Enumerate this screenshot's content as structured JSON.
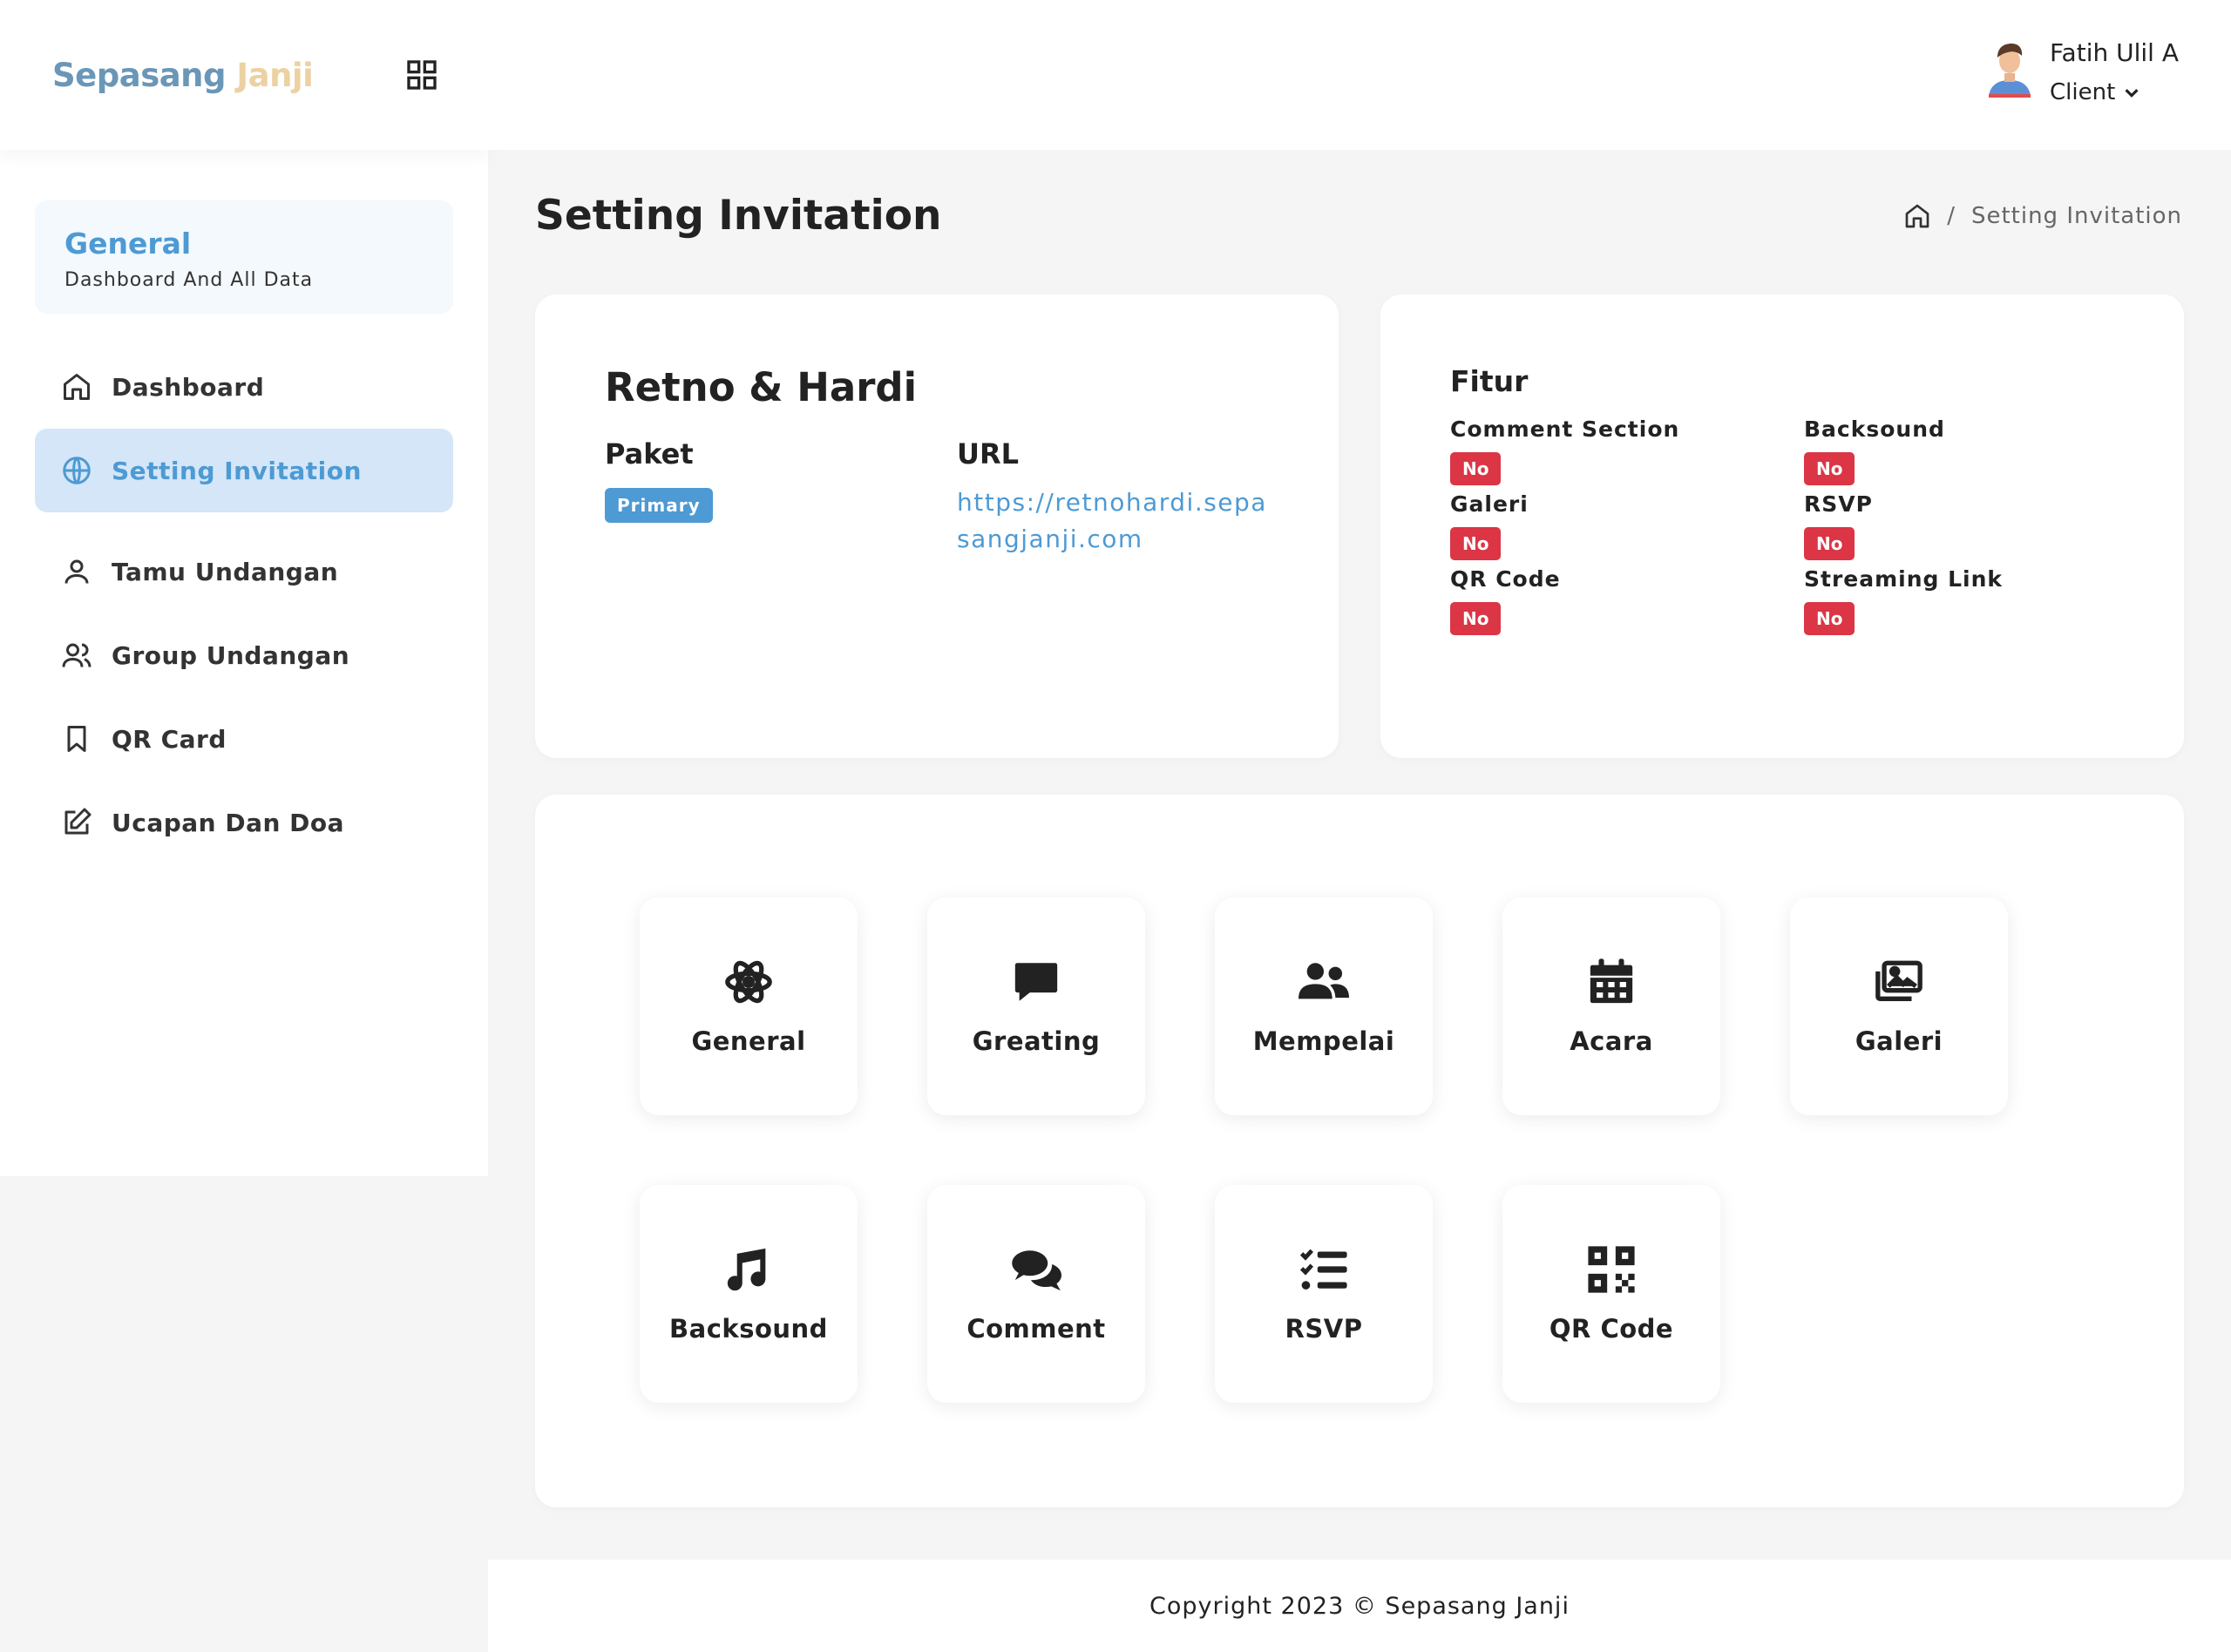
{
  "brand": {
    "part1": "Sepasang",
    "part2": "Janji"
  },
  "user": {
    "name": "Fatih Ulil A",
    "role": "Client"
  },
  "sidebar": {
    "section_title": "General",
    "section_subtitle": "Dashboard And All Data",
    "items": [
      {
        "label": "Dashboard",
        "icon": "home-icon"
      },
      {
        "label": "Setting Invitation",
        "icon": "globe-icon",
        "active": true
      },
      {
        "label": "Tamu Undangan",
        "icon": "user-icon"
      },
      {
        "label": "Group Undangan",
        "icon": "users-icon"
      },
      {
        "label": "QR Card",
        "icon": "bookmark-icon"
      },
      {
        "label": "Ucapan Dan Doa",
        "icon": "edit-icon"
      }
    ]
  },
  "page": {
    "title": "Setting Invitation"
  },
  "breadcrumb": {
    "separator": "/",
    "current": "Setting Invitation"
  },
  "couple_card": {
    "name": "Retno & Hardi",
    "paket_label": "Paket",
    "paket_value": "Primary",
    "url_label": "URL",
    "url_value": "https://retnohardi.sepasangjanji.com"
  },
  "fitur_card": {
    "title": "Fitur",
    "features": [
      {
        "label": "Comment Section",
        "value": "No"
      },
      {
        "label": "Backsound",
        "value": "No"
      },
      {
        "label": "Galeri",
        "value": "No"
      },
      {
        "label": "RSVP",
        "value": "No"
      },
      {
        "label": "QR Code",
        "value": "No"
      },
      {
        "label": "Streaming Link",
        "value": "No"
      }
    ]
  },
  "menu_tiles": [
    {
      "label": "General",
      "icon": "atom-icon"
    },
    {
      "label": "Greating",
      "icon": "message-icon"
    },
    {
      "label": "Mempelai",
      "icon": "users-icon"
    },
    {
      "label": "Acara",
      "icon": "calendar-icon"
    },
    {
      "label": "Galeri",
      "icon": "images-icon"
    },
    {
      "label": "Backsound",
      "icon": "music-icon"
    },
    {
      "label": "Comment",
      "icon": "comments-icon"
    },
    {
      "label": "RSVP",
      "icon": "list-check-icon"
    },
    {
      "label": "QR Code",
      "icon": "qrcode-icon"
    }
  ],
  "footer": {
    "text": "Copyright 2023 © Sepasang Janji"
  },
  "colors": {
    "accent": "#4d9ad4",
    "brand_blue": "#6a97b7",
    "brand_gold": "#ecd1a2",
    "danger": "#dc3545",
    "active_bg": "#d4e6f7"
  }
}
